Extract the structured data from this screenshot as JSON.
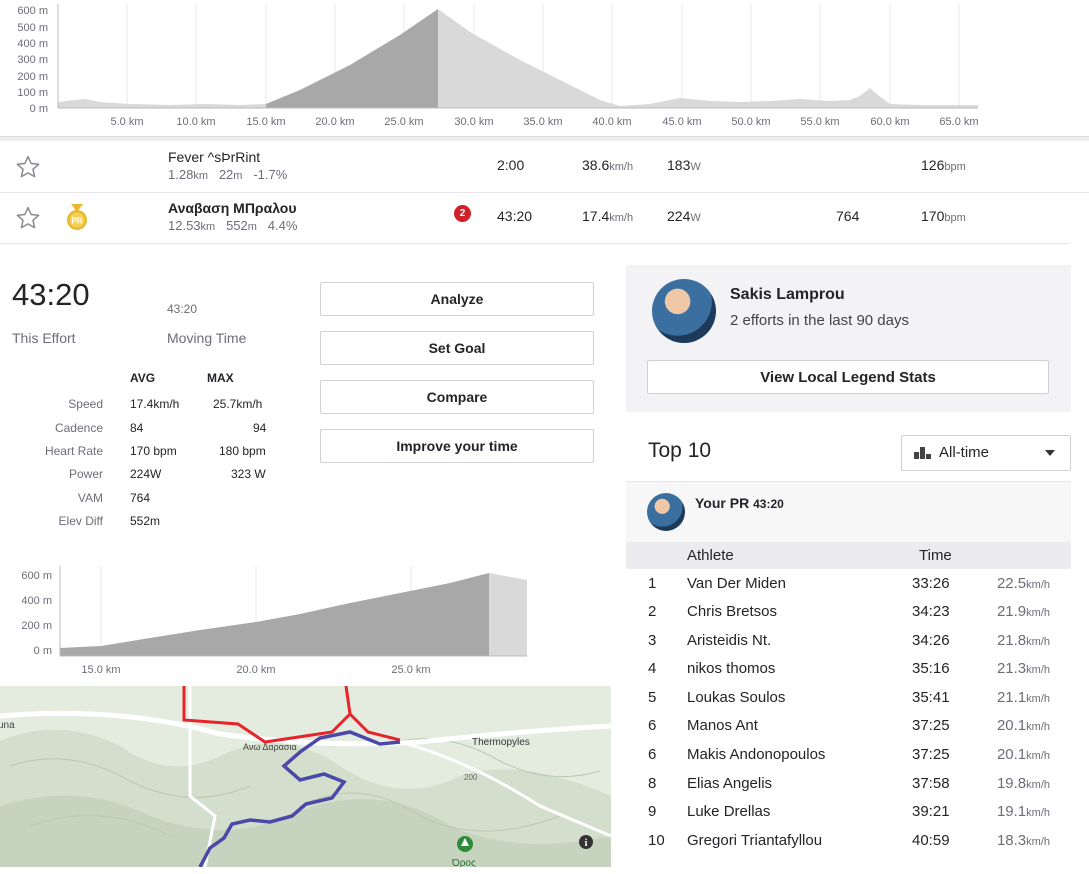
{
  "top_chart": {
    "y_ticks": [
      "600 m",
      "500 m",
      "400 m",
      "300 m",
      "200 m",
      "100 m",
      "0 m"
    ],
    "x_ticks": [
      "5.0 km",
      "10.0 km",
      "15.0 km",
      "20.0 km",
      "25.0 km",
      "30.0 km",
      "35.0 km",
      "40.0 km",
      "45.0 km",
      "50.0 km",
      "55.0 km",
      "60.0 km",
      "65.0 km"
    ]
  },
  "segments": [
    {
      "name": "Fever ^sÞrRint",
      "distance": "1.28",
      "distance_unit": "km",
      "elev": "22",
      "elev_unit": "m",
      "grade": "-1.7%",
      "time": "2:00",
      "speed": "38.6",
      "speed_unit": "km/h",
      "power": "183",
      "power_unit": "W",
      "vam": "",
      "hr": "126",
      "hr_unit": "bpm",
      "badge": "",
      "rank_badge": ""
    },
    {
      "name": "Αναβαση ΜΠραλου",
      "distance": "12.53",
      "distance_unit": "km",
      "elev": "552",
      "elev_unit": "m",
      "grade": "4.4%",
      "time": "43:20",
      "speed": "17.4",
      "speed_unit": "km/h",
      "power": "224",
      "power_unit": "W",
      "vam": "764",
      "hr": "170",
      "hr_unit": "bpm",
      "badge": "PR",
      "rank_badge": "2"
    }
  ],
  "effort": {
    "time": "43:20",
    "time_label": "This Effort",
    "moving_time": "43:20",
    "moving_label": "Moving Time",
    "avg_header": "AVG",
    "max_header": "MAX",
    "stats": [
      {
        "label": "Speed",
        "avg": "17.4km/h",
        "max": "25.7km/h"
      },
      {
        "label": "Cadence",
        "avg": "84",
        "max": "94"
      },
      {
        "label": "Heart Rate",
        "avg": "170 bpm",
        "max": "180 bpm"
      },
      {
        "label": "Power",
        "avg": "224W",
        "max": "323 W"
      },
      {
        "label": "VAM",
        "avg": "764",
        "max": ""
      },
      {
        "label": "Elev Diff",
        "avg": "552m",
        "max": ""
      }
    ]
  },
  "buttons": {
    "analyze": "Analyze",
    "set_goal": "Set Goal",
    "compare": "Compare",
    "improve": "Improve your time"
  },
  "small_chart": {
    "y_ticks": [
      "600 m",
      "400 m",
      "200 m",
      "0 m"
    ],
    "x_ticks": [
      "15.0 km",
      "20.0 km",
      "25.0 km"
    ]
  },
  "map": {
    "labels": [
      "una",
      "Ανω Δαρασια",
      "Thermopyles",
      "200",
      "Όρος"
    ],
    "route_colors": {
      "red": "#e8242a",
      "blue": "#4a48a8"
    }
  },
  "legend": {
    "name": "Sakis Lamprou",
    "efforts": "2 efforts in the last 90 days",
    "button": "View Local Legend Stats"
  },
  "top10": {
    "title": "Top 10",
    "filter": "All-time",
    "your_pr_label": "Your PR",
    "your_pr_time": "43:20",
    "col_athlete": "Athlete",
    "col_time": "Time",
    "rows": [
      {
        "rank": "1",
        "name": "Van Der Miden",
        "time": "33:26",
        "speed": "22.5",
        "unit": "km/h"
      },
      {
        "rank": "2",
        "name": "Chris Bretsos",
        "time": "34:23",
        "speed": "21.9",
        "unit": "km/h"
      },
      {
        "rank": "3",
        "name": "Aristeidis Nt.",
        "time": "34:26",
        "speed": "21.8",
        "unit": "km/h"
      },
      {
        "rank": "4",
        "name": "nikos thomos",
        "time": "35:16",
        "speed": "21.3",
        "unit": "km/h"
      },
      {
        "rank": "5",
        "name": "Loukas Soulos",
        "time": "35:41",
        "speed": "21.1",
        "unit": "km/h"
      },
      {
        "rank": "6",
        "name": "Manos Ant",
        "time": "37:25",
        "speed": "20.1",
        "unit": "km/h"
      },
      {
        "rank": "6",
        "name": "Makis Andonopoulos",
        "time": "37:25",
        "speed": "20.1",
        "unit": "km/h"
      },
      {
        "rank": "8",
        "name": "Elias Angelis",
        "time": "37:58",
        "speed": "19.8",
        "unit": "km/h"
      },
      {
        "rank": "9",
        "name": "Luke Drellas",
        "time": "39:21",
        "speed": "19.1",
        "unit": "km/h"
      },
      {
        "rank": "10",
        "name": "Gregori Triantafyllou",
        "time": "40:59",
        "speed": "18.3",
        "unit": "km/h"
      }
    ]
  },
  "colors": {
    "accent": "#fc5200",
    "rank_badge": "#d0202a",
    "pr_medal": "#e9b82c",
    "text": "#242428",
    "muted": "#6d6d78"
  }
}
